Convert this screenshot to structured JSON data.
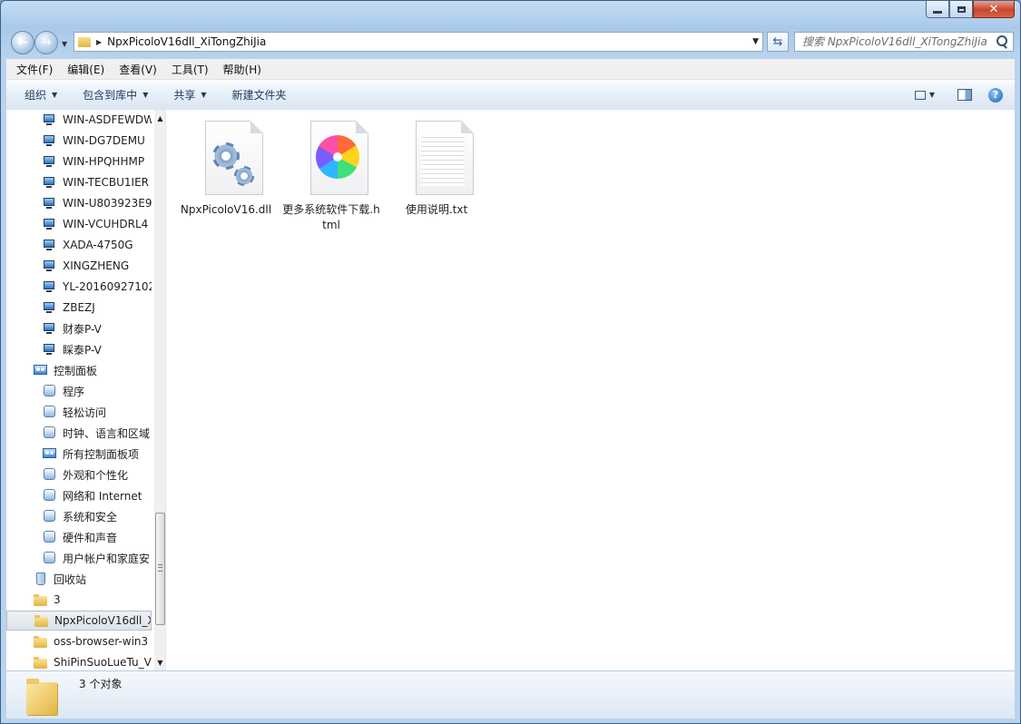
{
  "window": {
    "title": "NpxPicoloV16dll_XiTongZhiJia",
    "close_glyph": "✕"
  },
  "address": {
    "path": "NpxPicoloV16dll_XiTongZhiJia"
  },
  "search": {
    "placeholder": "搜索 NpxPicoloV16dll_XiTongZhiJia"
  },
  "menubar": [
    "文件(F)",
    "编辑(E)",
    "查看(V)",
    "工具(T)",
    "帮助(H)"
  ],
  "commandbar": [
    {
      "label": "组织",
      "has_caret": true
    },
    {
      "label": "包含到库中",
      "has_caret": true
    },
    {
      "label": "共享",
      "has_caret": true
    },
    {
      "label": "新建文件夹",
      "has_caret": false
    }
  ],
  "navpane": {
    "items": [
      {
        "label": "WIN-ASDFEWDW",
        "icon": "computer-icon",
        "indent": 2
      },
      {
        "label": "WIN-DG7DEMU",
        "icon": "computer-icon",
        "indent": 2
      },
      {
        "label": "WIN-HPQHHMP",
        "icon": "computer-icon",
        "indent": 2
      },
      {
        "label": "WIN-TECBU1IER",
        "icon": "computer-icon",
        "indent": 2
      },
      {
        "label": "WIN-U803923E9",
        "icon": "computer-icon",
        "indent": 2
      },
      {
        "label": "WIN-VCUHDRL4",
        "icon": "computer-icon",
        "indent": 2
      },
      {
        "label": "XADA-4750G",
        "icon": "computer-icon",
        "indent": 2
      },
      {
        "label": "XINGZHENG",
        "icon": "computer-icon",
        "indent": 2
      },
      {
        "label": "YL-20160927102",
        "icon": "computer-icon",
        "indent": 2
      },
      {
        "label": "ZBEZJ",
        "icon": "computer-icon",
        "indent": 2
      },
      {
        "label": "财泰P-V",
        "icon": "computer-icon",
        "indent": 2
      },
      {
        "label": "睬泰P-V",
        "icon": "computer-icon",
        "indent": 2
      },
      {
        "label": "控制面板",
        "icon": "control-panel-icon",
        "indent": 1
      },
      {
        "label": "程序",
        "icon": "programs-icon",
        "indent": 2
      },
      {
        "label": "轻松访问",
        "icon": "ease-of-access-icon",
        "indent": 2
      },
      {
        "label": "时钟、语言和区域",
        "icon": "clock-language-icon",
        "indent": 2
      },
      {
        "label": "所有控制面板项",
        "icon": "control-panel-icon",
        "indent": 2
      },
      {
        "label": "外观和个性化",
        "icon": "appearance-icon",
        "indent": 2
      },
      {
        "label": "网络和 Internet",
        "icon": "network-icon",
        "indent": 2
      },
      {
        "label": "系统和安全",
        "icon": "system-security-icon",
        "indent": 2
      },
      {
        "label": "硬件和声音",
        "icon": "hardware-sound-icon",
        "indent": 2
      },
      {
        "label": "用户帐户和家庭安",
        "icon": "user-accounts-icon",
        "indent": 2
      },
      {
        "label": "回收站",
        "icon": "recycle-bin-icon",
        "indent": 1
      },
      {
        "label": "3",
        "icon": "folder-icon",
        "indent": 1
      },
      {
        "label": "NpxPicoloV16dll_X",
        "icon": "folder-icon",
        "indent": 1,
        "selected": true
      },
      {
        "label": "oss-browser-win3",
        "icon": "folder-icon",
        "indent": 1
      },
      {
        "label": "ShiPinSuoLueTu_V",
        "icon": "folder-icon",
        "indent": 1
      }
    ]
  },
  "files": [
    {
      "name": "NpxPicoloV16.dll",
      "type": "dll",
      "icon": "dll-gear-icon"
    },
    {
      "name": "更多系统软件下载.html",
      "type": "html",
      "icon": "browser-pinwheel-icon"
    },
    {
      "name": "使用说明.txt",
      "type": "txt",
      "icon": "text-file-icon"
    }
  ],
  "status": {
    "count_text": "3 个对象"
  },
  "colors": {
    "frame": "#b9d3ee",
    "command_text": "#1e395b",
    "close_button": "#c8452c"
  }
}
